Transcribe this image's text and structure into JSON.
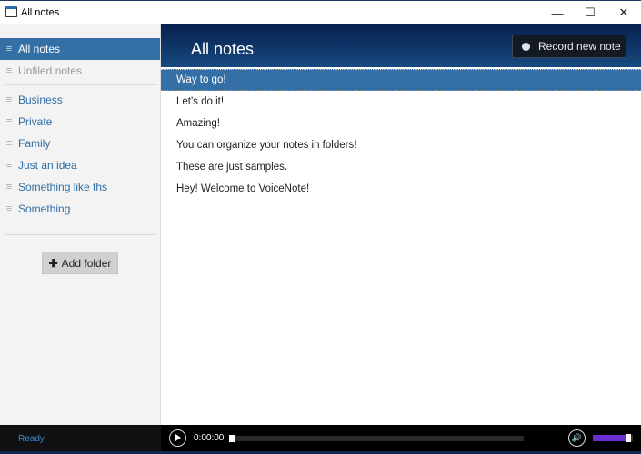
{
  "window": {
    "title": "All notes",
    "controls": {
      "minimize": "—",
      "maximize": "☐",
      "close": "✕"
    }
  },
  "sidebar": {
    "items": [
      {
        "label": "All notes",
        "selected": true
      },
      {
        "label": "Unfiled notes"
      }
    ],
    "folders": [
      {
        "label": "Business"
      },
      {
        "label": "Private"
      },
      {
        "label": "Family"
      },
      {
        "label": "Just an idea"
      },
      {
        "label": "Something like ths"
      },
      {
        "label": "Something"
      }
    ],
    "add_folder": "Add folder",
    "hamburger": "≡"
  },
  "header": {
    "title": "All notes",
    "record_label": "Record new note"
  },
  "notes": [
    "Way to go!",
    "Let's do it!",
    "Amazing!",
    "You can organize your notes in folders!",
    "These are just samples.",
    "Hey! Welcome to VoiceNote!"
  ],
  "footer": {
    "status": "Ready",
    "time": "0:00:00",
    "progress": 0,
    "volume": 0.9,
    "volume_icon": "🔊"
  },
  "colors": {
    "accent": "#3470a6",
    "volume": "#6a2fd0"
  }
}
